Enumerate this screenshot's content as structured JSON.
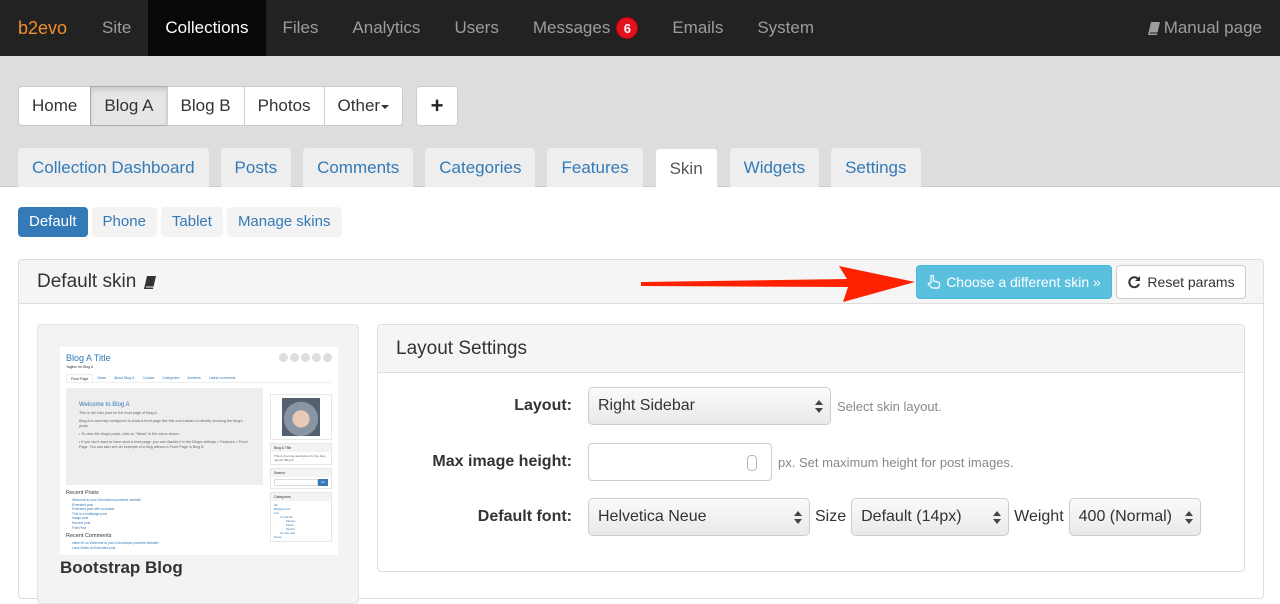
{
  "topnav": {
    "brand": "b2evo",
    "items": [
      {
        "label": "Site",
        "active": false
      },
      {
        "label": "Collections",
        "active": true
      },
      {
        "label": "Files",
        "active": false
      },
      {
        "label": "Analytics",
        "active": false
      },
      {
        "label": "Users",
        "active": false
      },
      {
        "label": "Messages",
        "active": false,
        "badge": "6"
      },
      {
        "label": "Emails",
        "active": false
      },
      {
        "label": "System",
        "active": false
      }
    ],
    "manual_label": "Manual page"
  },
  "collections": {
    "items": [
      {
        "label": "Home",
        "active": false
      },
      {
        "label": "Blog A",
        "active": true
      },
      {
        "label": "Blog B",
        "active": false
      },
      {
        "label": "Photos",
        "active": false
      },
      {
        "label": "Other",
        "active": false
      }
    ],
    "add_label": "+"
  },
  "tabs": [
    {
      "label": "Collection Dashboard",
      "active": false
    },
    {
      "label": "Posts",
      "active": false
    },
    {
      "label": "Comments",
      "active": false
    },
    {
      "label": "Categories",
      "active": false
    },
    {
      "label": "Features",
      "active": false
    },
    {
      "label": "Skin",
      "active": true
    },
    {
      "label": "Widgets",
      "active": false
    },
    {
      "label": "Settings",
      "active": false
    }
  ],
  "subtabs": [
    {
      "label": "Default",
      "active": true
    },
    {
      "label": "Phone",
      "active": false
    },
    {
      "label": "Tablet",
      "active": false
    },
    {
      "label": "Manage skins",
      "active": false
    }
  ],
  "panel": {
    "title": "Default skin",
    "choose_label": "Choose a different skin »",
    "reset_label": "Reset params"
  },
  "preview": {
    "skin_name": "Bootstrap Blog",
    "thumb": {
      "blog_title": "Blog A Title",
      "tagline": "Tagline for Blog A",
      "nav": [
        "Front Page",
        "News",
        "About Blog A",
        "Contact",
        "Categories",
        "Archives",
        "Latest comments"
      ],
      "intro_title": "Welcome to Blog A",
      "intro_p1": "This is the intro post for the front page of Blog A.",
      "intro_p2": "Blog A is currently configured to show a front page like this one instead of directly showing the blog's posts.",
      "intro_li1": "• To view the blog's posts, click on \"News\" in the menu above.",
      "intro_li2": "• If you don't want to have such a front page, you can disable it in the Blog's settings > Features > Front Page. You can also see an example of a blog without a Front Page in Blog B",
      "recent_posts_title": "Recent Posts",
      "recent_posts": [
        "Welcome to your b2evolution-powered website!",
        "Extended post",
        "Extended post with no teaser",
        "This is a multipage post",
        "Image post",
        "Second post",
        "First Post"
      ],
      "recent_comments_title": "Recent Comments",
      "recent_comments": [
        "miles b2 on Welcome to your b2evolution-powered website!",
        "Larry Smith on Extended post"
      ],
      "side_title": "Blog A Title",
      "side_desc": "This is the long description for the blog named 'Blog A'.",
      "search_title": "Search",
      "search_btn": "Go",
      "categories_title": "Categories",
      "categories": [
        "All",
        "Background",
        "Fun",
        "In real life",
        "Movies",
        "Music",
        "Sports",
        "On the web",
        "News"
      ]
    }
  },
  "layout_settings": {
    "title": "Layout Settings",
    "layout": {
      "label": "Layout:",
      "value": "Right Sidebar",
      "hint": "Select skin layout."
    },
    "max_image_height": {
      "label": "Max image height:",
      "value": "",
      "hint": "px. Set maximum height for post images."
    },
    "default_font": {
      "label": "Default font:",
      "value": "Helvetica Neue",
      "size_label": "Size",
      "size_value": "Default (14px)",
      "weight_label": "Weight",
      "weight_value": "400 (Normal)"
    }
  },
  "colors": {
    "brand": "#f38f2b",
    "topnav_bg": "#222222",
    "link": "#337ab7",
    "info_button": "#5bc0de",
    "badge": "#e0141e",
    "annotation_arrow": "#ff2200"
  }
}
